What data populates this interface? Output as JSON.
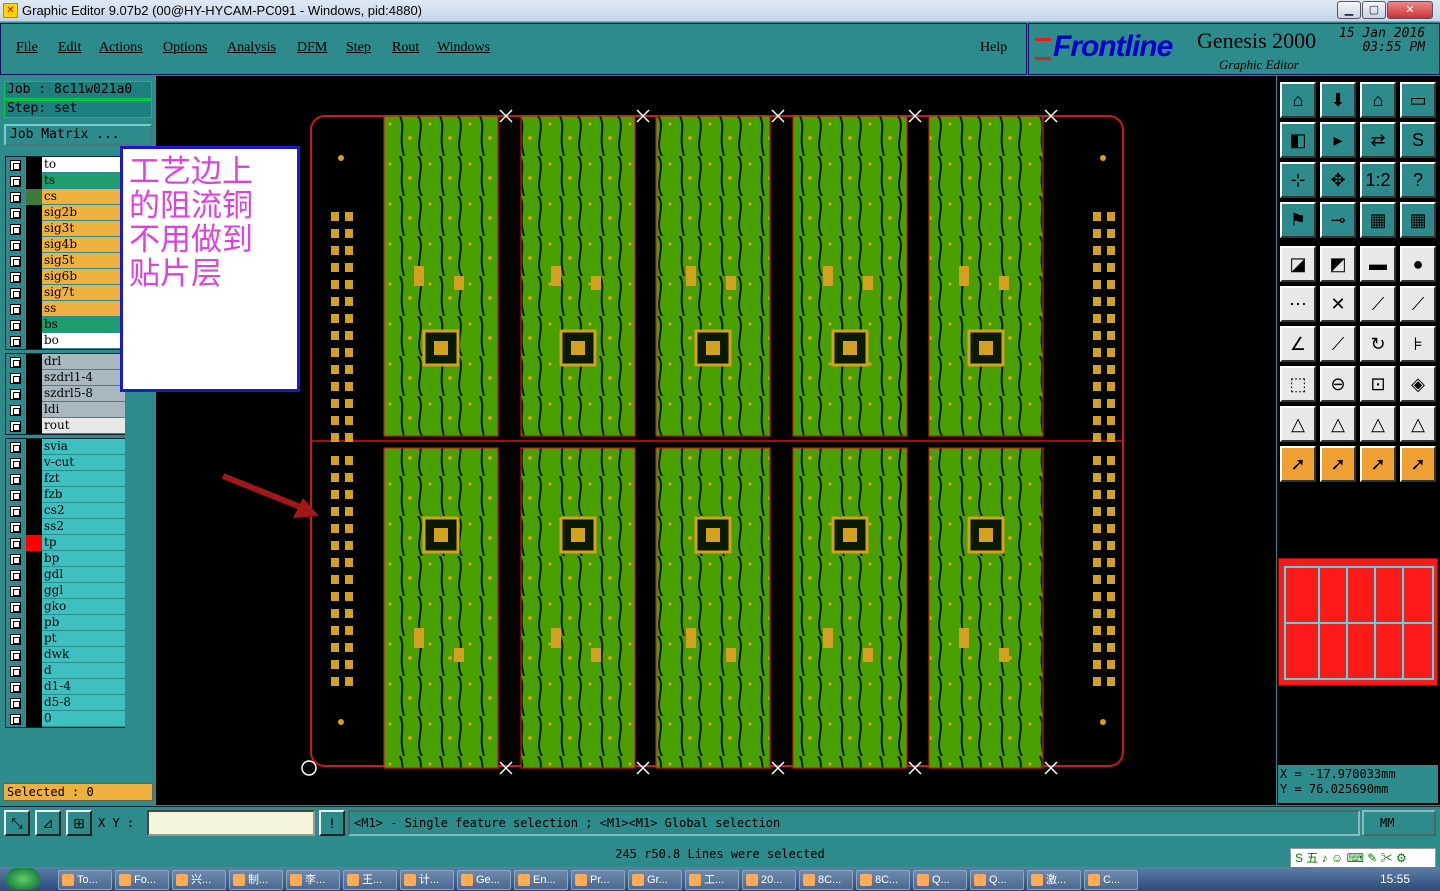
{
  "window": {
    "title": "Graphic Editor 9.07b2 (00@HY-HYCAM-PC091 - Windows, pid:4880)",
    "buttons": [
      "▁",
      "▢",
      "✕"
    ]
  },
  "menu": {
    "items": [
      "File",
      "Edit",
      "Actions",
      "Options",
      "Analysis",
      "DFM",
      "Step",
      "Rout",
      "Windows"
    ],
    "help": "Help"
  },
  "brand": {
    "logo": "Frontline",
    "product": "Genesis 2000",
    "subtitle": "Graphic Editor",
    "date": "15 Jan 2016",
    "time": "03:55 PM"
  },
  "job": {
    "job_label": "Job : 8c11w021a0",
    "step_label": "Step: set",
    "matrix_button": "Job Matrix ..."
  },
  "layers": {
    "group1": [
      {
        "name": "to",
        "color": "#ffffff",
        "swatch": "#000000"
      },
      {
        "name": "ts",
        "color": "#1e9e6e",
        "swatch": "#000000"
      },
      {
        "name": "cs",
        "color": "#f0b040",
        "swatch": "#3a7a3a"
      },
      {
        "name": "sig2b",
        "color": "#f0b040",
        "swatch": "#000000"
      },
      {
        "name": "sig3t",
        "color": "#f0b040",
        "swatch": "#000000"
      },
      {
        "name": "sig4b",
        "color": "#f0b040",
        "swatch": "#000000"
      },
      {
        "name": "sig5t",
        "color": "#f0b040",
        "swatch": "#000000"
      },
      {
        "name": "sig6b",
        "color": "#f0b040",
        "swatch": "#000000"
      },
      {
        "name": "sig7t",
        "color": "#f0b040",
        "swatch": "#000000"
      },
      {
        "name": "ss",
        "color": "#f0b040",
        "swatch": "#000000"
      },
      {
        "name": "bs",
        "color": "#1e9e6e",
        "swatch": "#000000"
      },
      {
        "name": "bo",
        "color": "#ffffff",
        "swatch": "#000000"
      }
    ],
    "group2": [
      {
        "name": "drl",
        "color": "#a8b8c0",
        "swatch": "#000000"
      },
      {
        "name": "szdrl1-4",
        "color": "#a8b8c0",
        "swatch": "#000000"
      },
      {
        "name": "szdrl5-8",
        "color": "#a8b8c0",
        "swatch": "#000000"
      },
      {
        "name": "ldi",
        "color": "#a8b8c0",
        "swatch": "#000000"
      },
      {
        "name": "rout",
        "color": "#e8e8e8",
        "swatch": "#000000"
      }
    ],
    "group3": [
      {
        "name": "svia",
        "color": "#3ec0c0",
        "swatch": "#000000"
      },
      {
        "name": "v-cut",
        "color": "#3ec0c0",
        "swatch": "#000000"
      },
      {
        "name": "fzt",
        "color": "#3ec0c0",
        "swatch": "#000000"
      },
      {
        "name": "fzb",
        "color": "#3ec0c0",
        "swatch": "#000000"
      },
      {
        "name": "cs2",
        "color": "#3ec0c0",
        "swatch": "#000000"
      },
      {
        "name": "ss2",
        "color": "#3ec0c0",
        "swatch": "#000000"
      },
      {
        "name": "tp",
        "color": "#3ec0c0",
        "swatch": "#ff0000"
      },
      {
        "name": "bp",
        "color": "#3ec0c0",
        "swatch": "#000000"
      },
      {
        "name": "gdl",
        "color": "#3ec0c0",
        "swatch": "#000000"
      },
      {
        "name": "ggl",
        "color": "#3ec0c0",
        "swatch": "#000000"
      },
      {
        "name": "gko",
        "color": "#3ec0c0",
        "swatch": "#000000"
      },
      {
        "name": "pb",
        "color": "#3ec0c0",
        "swatch": "#000000"
      },
      {
        "name": "pt",
        "color": "#3ec0c0",
        "swatch": "#000000"
      },
      {
        "name": "dwk",
        "color": "#3ec0c0",
        "swatch": "#000000"
      },
      {
        "name": "d",
        "color": "#3ec0c0",
        "swatch": "#000000"
      },
      {
        "name": "d1-4",
        "color": "#3ec0c0",
        "swatch": "#000000"
      },
      {
        "name": "d5-8",
        "color": "#3ec0c0",
        "swatch": "#000000"
      },
      {
        "name": "0",
        "color": "#3ec0c0",
        "swatch": "#000000"
      }
    ]
  },
  "selected": "Selected : 0",
  "annotation": "工艺边上\n的阻流铜\n不用做到\n贴片层",
  "coords": {
    "x": "X = -17.970033mm",
    "y": "Y = 76.025690mm"
  },
  "bottom": {
    "xy_label": "X Y :",
    "xy_value": "",
    "alert": "!",
    "hint": "<M1> - Single feature selection ; <M1><M1> Global selection",
    "unit": "MM"
  },
  "status": "245 r50.8 Lines were selected",
  "ime": "S 五 ♪ ☺ ⌨ ✎ ✂ ⚙",
  "taskbar": {
    "items": [
      "To...",
      "Fo...",
      "兴...",
      "制...",
      "李...",
      "王...",
      "计...",
      "Ge...",
      "En...",
      "Pr...",
      "Gr...",
      "工...",
      "20...",
      "8C...",
      "8C...",
      "Q...",
      "Q...",
      "激...",
      "C..."
    ],
    "clock": "15:55"
  },
  "tools": [
    "home-icon",
    "save-icon",
    "building-icon",
    "window-icon",
    "left-icon",
    "right-icon",
    "swap-icon",
    "s-icon",
    "fit-icon",
    "zoom-icon",
    "ratio-icon",
    "help-icon",
    "flag-icon",
    "key-icon",
    "grid-icon",
    "grid2-icon",
    "square-icon",
    "eraser-icon",
    "ruler-icon",
    "dot-icon",
    "link-icon",
    "cross-icon",
    "line-icon",
    "line2-icon",
    "angle-icon",
    "slash-icon",
    "arc-icon",
    "ff-icon",
    "move-icon",
    "line3-icon",
    "box-icon",
    "shapes-icon",
    "tri1-icon",
    "tri2-icon",
    "tri3-icon",
    "tri4-icon",
    "cursor1-icon",
    "cursor2-icon",
    "cursor3-icon",
    "cursor4-icon"
  ],
  "colors": {
    "accent": "#2e8b8b",
    "panel_copper": "#4aa000",
    "outline": "#d01818"
  }
}
